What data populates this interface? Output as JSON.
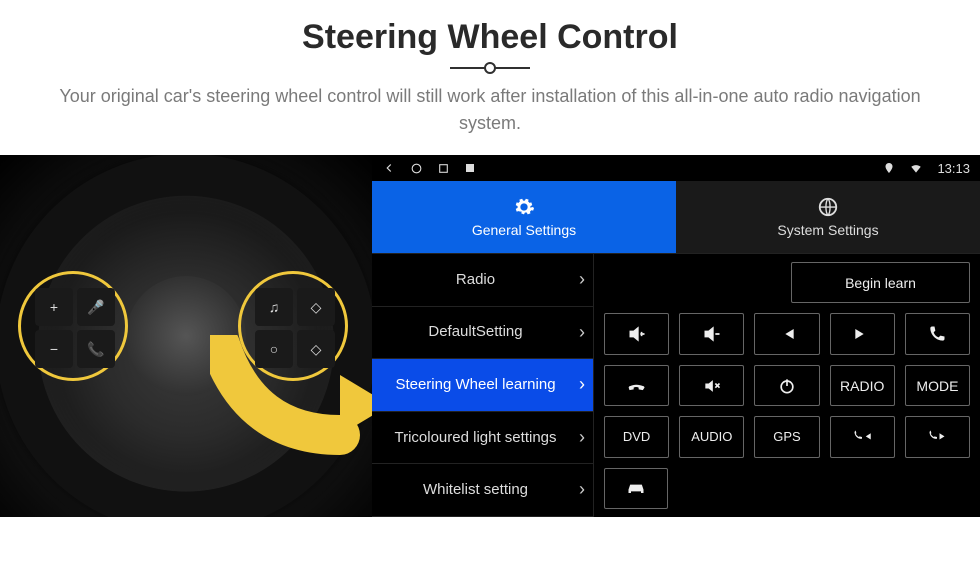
{
  "header": {
    "title": "Steering Wheel Control",
    "subtitle": "Your original car's steering wheel control will still work after installation of this all-in-one auto radio navigation system."
  },
  "statusbar": {
    "time": "13:13"
  },
  "tabs": {
    "general": "General Settings",
    "system": "System Settings"
  },
  "sidelist": [
    {
      "label": "Radio",
      "active": false
    },
    {
      "label": "DefaultSetting",
      "active": false
    },
    {
      "label": "Steering Wheel learning",
      "active": true
    },
    {
      "label": "Tricoloured light settings",
      "active": false
    },
    {
      "label": "Whitelist setting",
      "active": false
    }
  ],
  "grid": {
    "begin_learn": "Begin learn",
    "radio": "RADIO",
    "mode": "MODE",
    "dvd": "DVD",
    "audio": "AUDIO",
    "gps": "GPS"
  },
  "wheel_buttons_left": [
    "+",
    "🎤",
    "−",
    "📞"
  ],
  "wheel_buttons_right": [
    "♫",
    "◇",
    "○",
    "◇"
  ]
}
